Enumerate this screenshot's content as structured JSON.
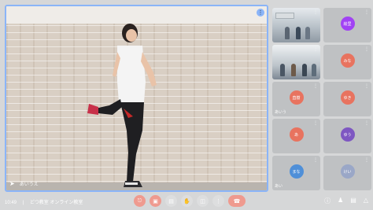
{
  "main": {
    "participant_name": "あいうえ",
    "pin_icon": "pin-icon"
  },
  "tiles": [
    {
      "type": "photo",
      "label": ""
    },
    {
      "type": "avatar",
      "initial": "絵里",
      "color": "#a142f4",
      "label": ""
    },
    {
      "type": "photo",
      "label": ""
    },
    {
      "type": "avatar",
      "initial": "みな",
      "color": "#e8735f",
      "label": ""
    },
    {
      "type": "avatar",
      "initial": "直樹",
      "color": "#e8735f",
      "label": "あいう"
    },
    {
      "type": "avatar",
      "initial": "ゆき",
      "color": "#e8735f",
      "label": ""
    },
    {
      "type": "avatar",
      "initial": "あ",
      "color": "#e8735f",
      "label": ""
    },
    {
      "type": "avatar",
      "initial": "ゆう",
      "color": "#7e57c2",
      "label": ""
    },
    {
      "type": "avatar",
      "initial": "まな",
      "color": "#4f8fd8",
      "label": "あい"
    },
    {
      "type": "avatar",
      "initial": "けい",
      "color": "#9aa7c7",
      "label": ""
    }
  ],
  "bottom": {
    "time": "10:49",
    "separator": "|",
    "meeting_title": "どつ教室 オンライン教室"
  },
  "colors": {
    "background": "#d6d7d8",
    "accent": "#8ab4f8",
    "control_red": "#ef9a8f"
  }
}
